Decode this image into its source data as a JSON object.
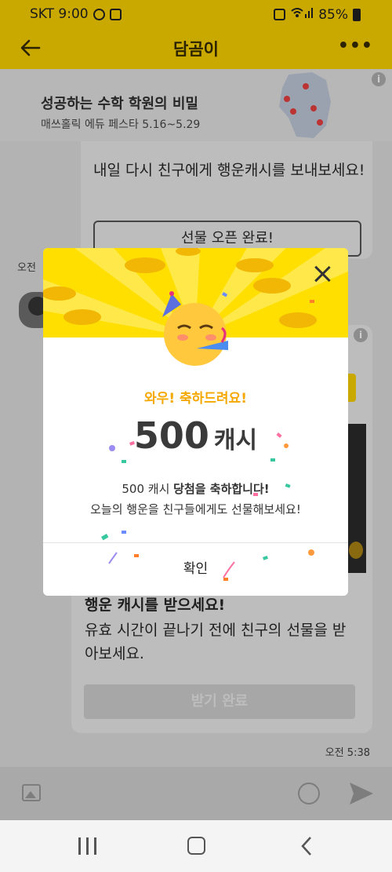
{
  "status_bar": {
    "carrier_time": "SKT 9:00",
    "battery": "85%"
  },
  "header": {
    "title": "담곰이"
  },
  "banner": {
    "title": "성공하는 수학 학원의 비밀",
    "subtitle": "매쓰홀릭 에듀 페스타 5.16~5.29",
    "info": "i"
  },
  "chat": {
    "message1": "내일 다시 친구에게 행운캐시를 보내보세요!",
    "gift_button": "선물 오픈 완료!",
    "time_am": "오전",
    "message2_title": "행운 캐시를 받으세요!",
    "message2_body": "유효 시간이 끝나기 전에 친구의 선물을 받아보세요.",
    "receive_button": "받기 완료",
    "last_time": "오전 5:38"
  },
  "dialog": {
    "congrats": "와우! 축하드려요!",
    "amount": "500",
    "unit": "캐시",
    "line1_prefix": "500 캐시 ",
    "line1_bold": "당첨을 축하합니다!",
    "line2": "오늘의 행운을 친구들에게도 선물해보세요!",
    "confirm": "확인"
  },
  "colors": {
    "accent_yellow": "#ffdf00",
    "congrats_orange": "#f5a800"
  }
}
